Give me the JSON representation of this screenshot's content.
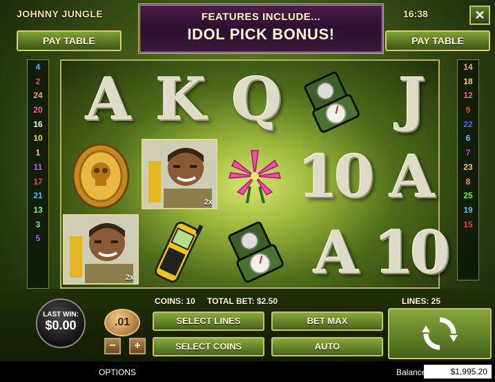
{
  "header": {
    "title": "JOHNNY JUNGLE",
    "clock": "16:38",
    "close_label": "✕",
    "pay_table_left": "PAY TABLE",
    "pay_table_right": "PAY TABLE"
  },
  "banner": {
    "line1": "FEATURES INCLUDE...",
    "line2": "IDOL PICK BONUS!"
  },
  "paylines": {
    "left": [
      {
        "n": "4",
        "color": "#4fb7ff"
      },
      {
        "n": "2",
        "color": "#ff4d4d"
      },
      {
        "n": "24",
        "color": "#f2b43c"
      },
      {
        "n": "20",
        "color": "#ff59a8"
      },
      {
        "n": "16",
        "color": "#f0f0f0"
      },
      {
        "n": "10",
        "color": "#f7d844"
      },
      {
        "n": "1",
        "color": "#ffd23a"
      },
      {
        "n": "11",
        "color": "#c35bff"
      },
      {
        "n": "17",
        "color": "#ff4040"
      },
      {
        "n": "21",
        "color": "#46c9ff"
      },
      {
        "n": "13",
        "color": "#6cff5a"
      },
      {
        "n": "3",
        "color": "#5aff86"
      },
      {
        "n": "5",
        "color": "#9966ff"
      }
    ],
    "right": [
      {
        "n": "14",
        "color": "#f2b43c"
      },
      {
        "n": "18",
        "color": "#ffd23a"
      },
      {
        "n": "12",
        "color": "#ff59a8"
      },
      {
        "n": "9",
        "color": "#ff4040"
      },
      {
        "n": "22",
        "color": "#4f6bff"
      },
      {
        "n": "6",
        "color": "#46c9ff"
      },
      {
        "n": "7",
        "color": "#c35bff"
      },
      {
        "n": "23",
        "color": "#ffd23a"
      },
      {
        "n": "8",
        "color": "#ff9a3c"
      },
      {
        "n": "25",
        "color": "#6cff5a"
      },
      {
        "n": "19",
        "color": "#46c9ff"
      },
      {
        "n": "15",
        "color": "#ff4040"
      }
    ]
  },
  "reels": {
    "row1": [
      "A",
      "K",
      "Q",
      "compass",
      "J"
    ],
    "row2": [
      "gold-coin",
      "johnny",
      "lotus",
      "10",
      "A"
    ],
    "row3": [
      "johnny",
      "walkie-talkie",
      "compass",
      "A",
      "10"
    ],
    "multiplier": "2x"
  },
  "controls": {
    "coins": "COINS: 10",
    "total_bet": "TOTAL BET: $2.50",
    "lines": "LINES: 25",
    "last_win_label": "LAST WIN:",
    "last_win_value": "$0.00",
    "coin_value": ".01",
    "minus": "−",
    "plus": "+",
    "select_lines": "SELECT LINES",
    "bet_max": "BET MAX",
    "select_coins": "SELECT COINS",
    "auto": "AUTO"
  },
  "status": {
    "options": "OPTIONS",
    "balance_label": "Balance",
    "balance_value": "$1,995.20"
  }
}
